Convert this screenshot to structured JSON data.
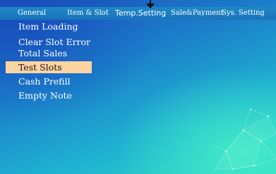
{
  "tabs": [
    {
      "label": "General",
      "active": true
    },
    {
      "label": "Item & Slot",
      "active": false
    },
    {
      "label": "Temp.Setting",
      "active": false
    },
    {
      "label": "Sale&Payment",
      "active": false
    },
    {
      "label": "Sys. Setting",
      "active": false
    }
  ],
  "menu": [
    {
      "label": "Item Loading",
      "selected": false
    },
    {
      "label": "Clear Slot Error",
      "selected": false
    },
    {
      "label": "Total Sales",
      "selected": false
    },
    {
      "label": "Test Slots",
      "selected": true
    },
    {
      "label": "Cash Prefill",
      "selected": false
    },
    {
      "label": "Empty Note",
      "selected": false
    }
  ],
  "colors": {
    "selected_bg": "#ffd4a3",
    "tab_bar": "#1a73bb",
    "background_start": "#1d4fb8",
    "background_end": "#33d6c6"
  },
  "icons": {
    "pointer": "down-arrow-icon"
  }
}
